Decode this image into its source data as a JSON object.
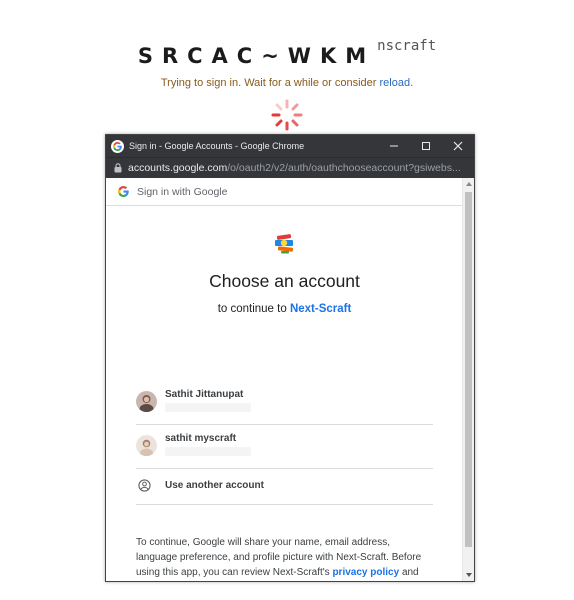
{
  "page": {
    "logo_code": "SRCAC~WKM",
    "logo_sub": "nscraft",
    "status_text": "Trying to sign in. Wait for a while or consider",
    "reload_link": "reload",
    "status_end": "."
  },
  "popup": {
    "window_title": "Sign in - Google Accounts - Google Chrome",
    "url_host": "accounts.google.com",
    "url_path": "/o/oauth2/v2/auth/oauthchooseaccount?gsiwebs...",
    "sign_in_with": "Sign in with Google",
    "heading": "Choose an account",
    "subheading_prefix": "to continue to",
    "app_name": "Next-Scraft",
    "accounts": [
      {
        "name": "Sathit Jittanupat"
      },
      {
        "name": "sathit myscraft"
      }
    ],
    "use_another": "Use another account",
    "disclaimer_before": "To continue, Google will share your name, email address, language preference, and profile picture with Next-Scraft. Before using this app, you can review Next-Scraft's",
    "privacy_link": "privacy policy",
    "disclaimer_after": "and terms of service."
  },
  "icons": {
    "spinner": "loading-spinner-icon",
    "google": "google-g-icon",
    "lock": "lock-icon",
    "account": "account-circle-icon"
  },
  "colors": {
    "titlebar": "#35363a",
    "link_blue": "#1a73e8",
    "status_brown": "#8a5a1a",
    "spinner_red": "#e53935"
  }
}
